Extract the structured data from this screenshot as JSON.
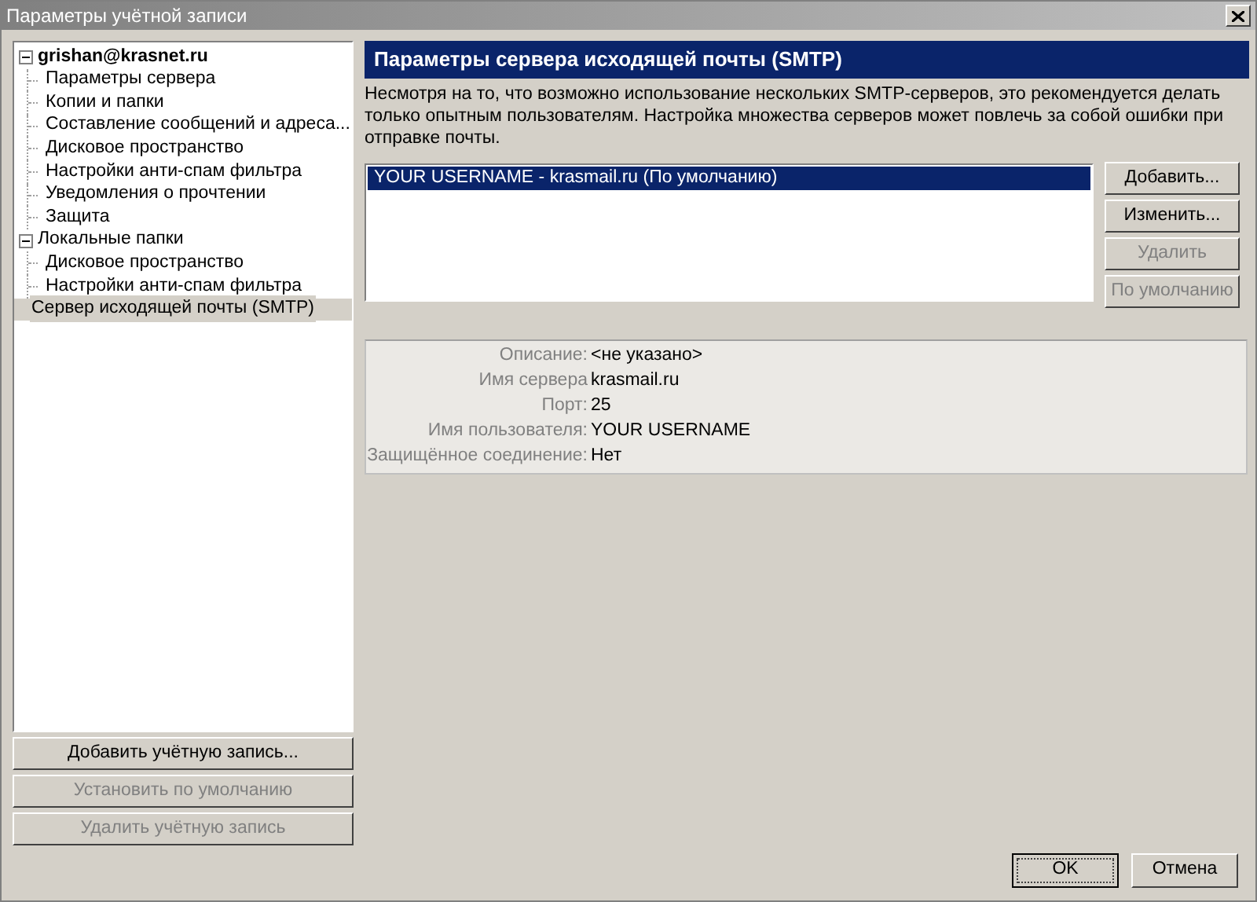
{
  "window": {
    "title": "Параметры учётной записи"
  },
  "tree": [
    {
      "label": "grishan@krasnet.ru",
      "expanded": true,
      "selected": false,
      "bold": true,
      "children": [
        {
          "label": "Параметры сервера",
          "selected": false
        },
        {
          "label": "Копии и папки",
          "selected": false
        },
        {
          "label": "Составление сообщений и адреса...",
          "selected": false
        },
        {
          "label": "Дисковое пространство",
          "selected": false
        },
        {
          "label": "Настройки анти-спам фильтра",
          "selected": false
        },
        {
          "label": "Уведомления о прочтении",
          "selected": false
        },
        {
          "label": "Защита",
          "selected": false
        }
      ]
    },
    {
      "label": "Локальные папки",
      "expanded": true,
      "selected": false,
      "bold": false,
      "children": [
        {
          "label": "Дисковое пространство",
          "selected": false
        },
        {
          "label": "Настройки анти-спам фильтра",
          "selected": false
        }
      ]
    },
    {
      "label": "Сервер исходящей почты (SMTP)",
      "selected": true
    }
  ],
  "account_buttons": [
    {
      "label": "Добавить учётную запись...",
      "disabled": false
    },
    {
      "label": "Установить по умолчанию",
      "disabled": true
    },
    {
      "label": "Удалить учётную запись",
      "disabled": true
    }
  ],
  "panel": {
    "heading": "Параметры сервера исходящей почты (SMTP)",
    "description": "Несмотря на то, что возможно использование нескольких SMTP-серверов, это рекомендуется делать только опытным пользователям. Настройка множества серверов может повлечь за собой ошибки при отправке почты.",
    "servers": [
      {
        "label": "YOUR USERNAME - krasmail.ru (По умолчанию)",
        "selected": true
      }
    ],
    "server_buttons": [
      {
        "label": "Добавить...",
        "disabled": false
      },
      {
        "label": "Изменить...",
        "disabled": false
      },
      {
        "label": "Удалить",
        "disabled": true
      },
      {
        "label": "По умолчанию",
        "disabled": true
      }
    ],
    "details": [
      {
        "label": "Описание:",
        "value": "<не указано>"
      },
      {
        "label": "Имя сервера",
        "value": "krasmail.ru"
      },
      {
        "label": "Порт:",
        "value": "25"
      },
      {
        "label": "Имя пользователя:",
        "value": "YOUR USERNAME"
      },
      {
        "label": "Защищённое соединение:",
        "value": "Нет"
      }
    ]
  },
  "dialog_buttons": [
    {
      "label": "OK",
      "default": true
    },
    {
      "label": "Отмена",
      "default": false
    }
  ]
}
